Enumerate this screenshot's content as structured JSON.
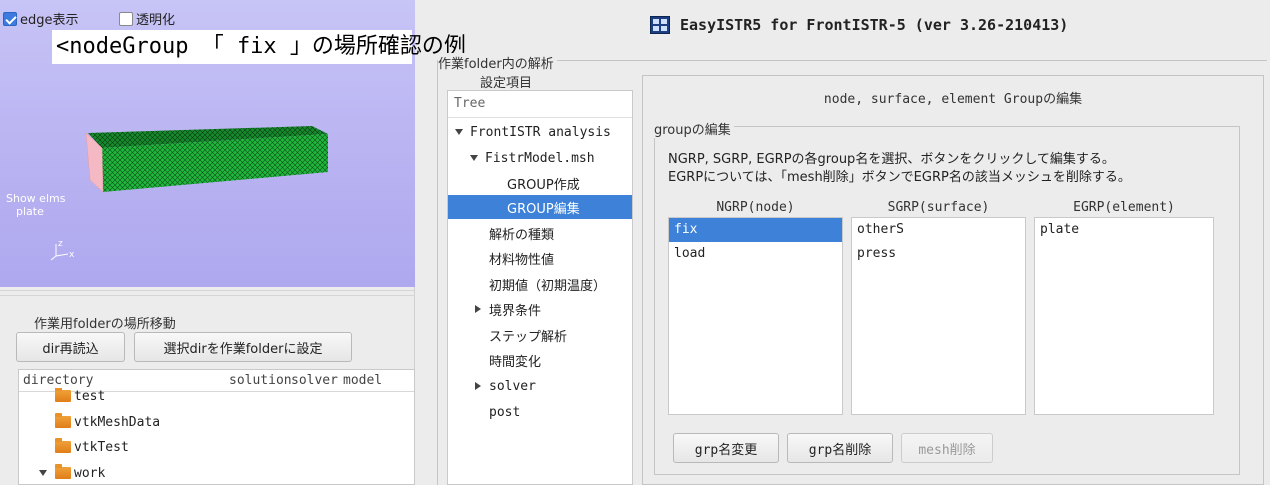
{
  "viewer": {
    "edge_label": "edge表示",
    "edge_checked": true,
    "transparent_label": "透明化",
    "transparent_checked": false,
    "caption": "<nodeGroup 「 fix 」の場所確認の例",
    "show_elms_line1": "Show elms",
    "show_elms_line2": "plate",
    "axis_z": "z",
    "axis_x": "x",
    "colors": {
      "bg": "#b9b3f2",
      "mesh": "#1fb43a",
      "fix_face": "#f4b9c2"
    }
  },
  "folder": {
    "label": "作業用folderの場所移動",
    "reload_button": "dir再読込",
    "set_button": "選択dirを作業folderに設定",
    "columns": [
      "directory",
      "solution",
      "solver",
      "model"
    ],
    "rows": [
      {
        "name": "test",
        "expanded": null
      },
      {
        "name": "vtkMeshData",
        "expanded": null
      },
      {
        "name": "vtkTest",
        "expanded": null
      },
      {
        "name": "work",
        "expanded": true
      }
    ]
  },
  "app": {
    "title": "EasyISTR5 for FrontISTR-5  (ver 3.26-210413)"
  },
  "analysis": {
    "group_label": "作業folder内の解析",
    "label2": "設定項目",
    "tree_header": "Tree",
    "tree": [
      {
        "label": "FrontISTR analysis",
        "arrow": "down",
        "selected": false
      },
      {
        "label": "FistrModel.msh",
        "arrow": "down",
        "selected": false
      },
      {
        "label": "GROUP作成",
        "arrow": null,
        "selected": false
      },
      {
        "label": "GROUP編集",
        "arrow": null,
        "selected": true
      },
      {
        "label": "解析の種類",
        "arrow": null,
        "selected": false
      },
      {
        "label": "材料物性値",
        "arrow": null,
        "selected": false
      },
      {
        "label": "初期値（初期温度）",
        "arrow": null,
        "selected": false
      },
      {
        "label": "境界条件",
        "arrow": "right",
        "selected": false
      },
      {
        "label": "ステップ解析",
        "arrow": null,
        "selected": false
      },
      {
        "label": "時間変化",
        "arrow": null,
        "selected": false
      },
      {
        "label": "solver",
        "arrow": "right",
        "selected": false
      },
      {
        "label": "post",
        "arrow": null,
        "selected": false
      }
    ]
  },
  "editor": {
    "title": "node, surface, element Groupの編集",
    "group_label": "groupの編集",
    "desc1": "NGRP, SGRP, EGRPの各group名を選択、ボタンをクリックして編集する。",
    "desc2": "EGRPについては、「mesh削除」ボタンでEGRP名の該当メッシュを削除する。",
    "ngrp": {
      "header": "NGRP(node)",
      "items": [
        "fix",
        "load"
      ],
      "selected": 0
    },
    "sgrp": {
      "header": "SGRP(surface)",
      "items": [
        "otherS",
        "press"
      ],
      "selected": -1
    },
    "egrp": {
      "header": "EGRP(element)",
      "items": [
        "plate"
      ],
      "selected": -1
    },
    "rename_button": "grp名変更",
    "delete_button": "grp名削除",
    "mesh_delete_button": "mesh削除",
    "mesh_delete_enabled": false,
    "selection_color": "#3d82d8"
  }
}
